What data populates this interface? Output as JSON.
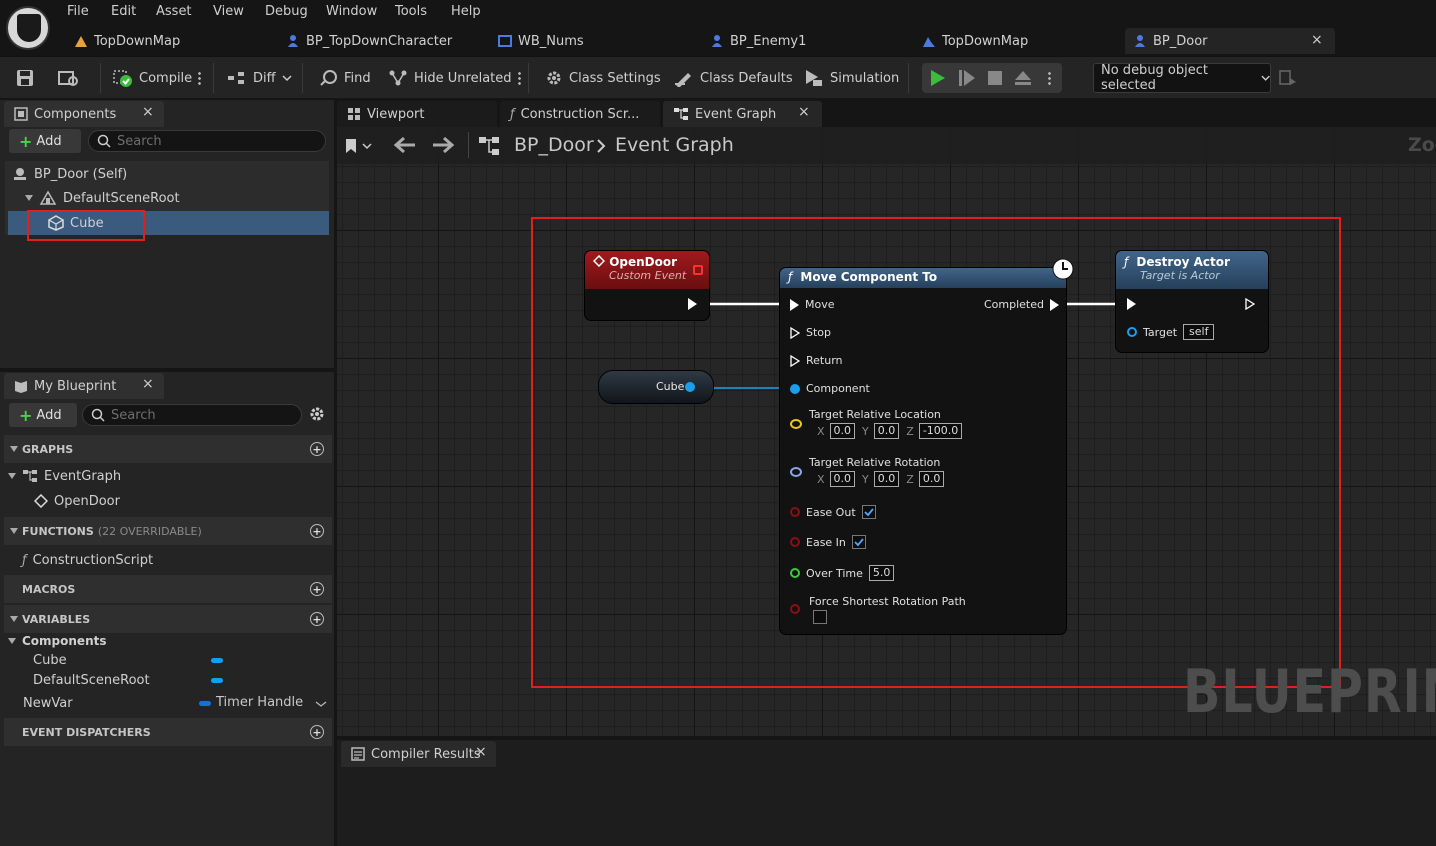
{
  "menu": [
    "File",
    "Edit",
    "Asset",
    "View",
    "Debug",
    "Window",
    "Tools",
    "Help"
  ],
  "tabs": [
    {
      "label": "TopDownMap",
      "icon": "map-icon"
    },
    {
      "label": "BP_TopDownCharacter",
      "icon": "character-icon"
    },
    {
      "label": "WB_Nums",
      "icon": "widget-icon"
    },
    {
      "label": "BP_Enemy1",
      "icon": "character-icon"
    },
    {
      "label": "TopDownMap",
      "icon": "map-icon"
    },
    {
      "label": "BP_Door",
      "icon": "blueprint-icon",
      "close": "×"
    }
  ],
  "toolbar": {
    "compile": "Compile",
    "diff": "Diff",
    "find": "Find",
    "hide_unrelated": "Hide Unrelated",
    "class_settings": "Class Settings",
    "class_defaults": "Class Defaults",
    "simulation": "Simulation",
    "debug_object": "No debug object selected"
  },
  "components": {
    "tab": "Components",
    "close": "×",
    "add": "Add",
    "search_placeholder": "Search",
    "items": [
      {
        "label": "BP_Door (Self)"
      },
      {
        "label": "DefaultSceneRoot"
      },
      {
        "label": "Cube"
      }
    ]
  },
  "my_blueprint": {
    "tab": "My Blueprint",
    "close": "×",
    "add": "Add",
    "search_placeholder": "Search",
    "graphs": {
      "title": "GRAPHS",
      "items": [
        "EventGraph",
        "OpenDoor"
      ]
    },
    "functions": {
      "title": "FUNCTIONS",
      "count": "(22 OVERRIDABLE)",
      "items": [
        "ConstructionScript"
      ]
    },
    "macros": {
      "title": "MACROS"
    },
    "variables": {
      "title": "VARIABLES",
      "group": "Components",
      "items": [
        "Cube",
        "DefaultSceneRoot"
      ],
      "newvar": {
        "name": "NewVar",
        "type": "Timer Handle"
      }
    },
    "dispatchers": {
      "title": "EVENT DISPATCHERS"
    }
  },
  "editor_tabs": [
    "Viewport",
    "Construction Scr...",
    "Event Graph"
  ],
  "editor_tab_close": "×",
  "breadcrumb": {
    "bp": "BP_Door",
    "graph": "Event Graph",
    "zoom": "Zoo"
  },
  "watermark": "BLUEPRIN",
  "nodes": {
    "open_door": {
      "title": "OpenDoor",
      "subtitle": "Custom Event"
    },
    "cube_var": {
      "label": "Cube"
    },
    "move": {
      "title": "Move Component To",
      "pins_in": [
        "Move",
        "Stop",
        "Return"
      ],
      "component": "Component",
      "completed": "Completed",
      "trl": {
        "label": "Target Relative Location",
        "x": "0.0",
        "y": "0.0",
        "z": "-100.0"
      },
      "trr": {
        "label": "Target Relative Rotation",
        "x": "0.0",
        "y": "0.0",
        "z": "0.0"
      },
      "ease_out": "Ease Out",
      "ease_in": "Ease In",
      "over_time": "Over Time",
      "over_time_val": "5.0",
      "force": "Force Shortest Rotation Path"
    },
    "destroy": {
      "title": "Destroy Actor",
      "subtitle": "Target is Actor",
      "target": "Target",
      "target_val": "self"
    }
  },
  "axes": {
    "x": "X",
    "y": "Y",
    "z": "Z"
  },
  "compiler": {
    "tab": "Compiler Results",
    "close": "×"
  },
  "colors": {
    "accent": "#0e7ad6",
    "highlight": "#e0201b",
    "event_header": "#8b1518",
    "function_header": "#3d5a78",
    "play": "#3bbd3b"
  }
}
